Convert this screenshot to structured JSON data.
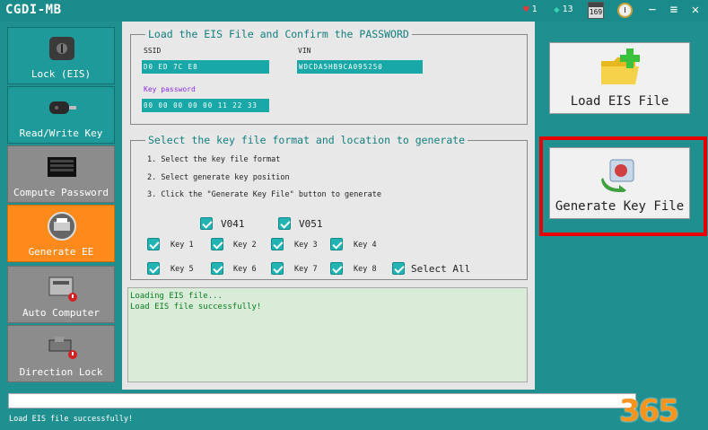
{
  "window": {
    "title": "CGDI-MB",
    "hearts": "1",
    "diamonds": "13",
    "calendar": "169",
    "minimize": "−",
    "menu": "≡",
    "close": "✕"
  },
  "sidebar": {
    "items": [
      {
        "label": "Lock (EIS)",
        "icon": "key-lock-icon"
      },
      {
        "label": "Read/Write Key",
        "icon": "car-key-icon"
      },
      {
        "label": "Compute Password",
        "icon": "keyboard-icon"
      },
      {
        "label": "Generate EE",
        "icon": "printer-icon"
      },
      {
        "label": "Auto Computer",
        "icon": "ecu-module-icon"
      },
      {
        "label": "Direction Lock",
        "icon": "steering-lock-icon"
      }
    ]
  },
  "eis_section": {
    "legend": "Load the EIS File and Confirm the PASSWORD",
    "ssid_label": "SSID",
    "ssid_value": "D0 ED 7C E8",
    "vin_label": "VIN",
    "vin_value": "WDCDA5HB9CA095250",
    "key_password_label": "Key password",
    "key_password_value": "00 00 00 00 00 11 22 33"
  },
  "keyfile_section": {
    "legend": "Select the key file format and location to generate",
    "steps": [
      "1. Select the key file format",
      "2. Select generate key position",
      "3. Click the \"Generate Key File\" button to generate"
    ],
    "formats": [
      "V041",
      "V051"
    ],
    "keys": [
      "Key 1",
      "Key 2",
      "Key 3",
      "Key 4",
      "Key 5",
      "Key 6",
      "Key 7",
      "Key 8"
    ],
    "select_all": "Select All"
  },
  "log": {
    "lines": [
      "Loading EIS file...",
      "Load EIS file successfully!"
    ]
  },
  "buttons": {
    "load_eis": "Load EIS File",
    "generate_key": "Generate Key File"
  },
  "status_text": "Load EIS file successfully!",
  "watermark": "365",
  "colors": {
    "teal": "#1f9a9a",
    "active": "#ff8a1c",
    "highlight": "#e80000"
  }
}
